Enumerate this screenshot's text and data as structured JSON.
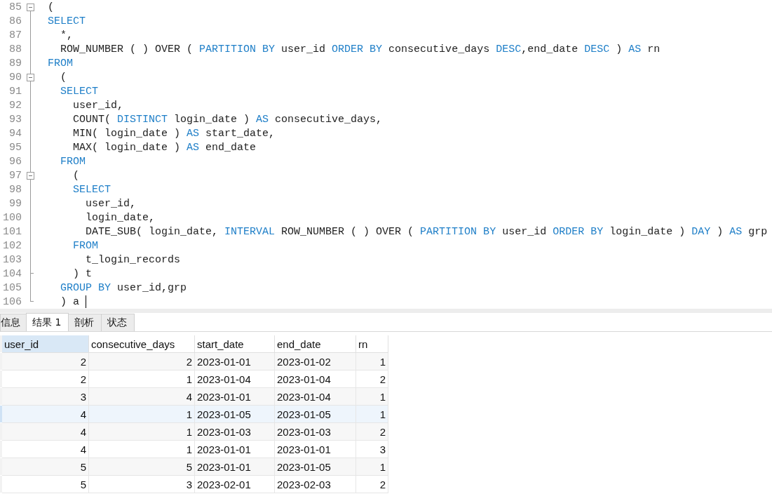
{
  "editor": {
    "lines": [
      {
        "number": "85",
        "kind": "fold-start",
        "tokens": [
          {
            "text": "(",
            "kind": "plain"
          }
        ]
      },
      {
        "number": "86",
        "kind": "code",
        "tokens": [
          {
            "text": "SELECT",
            "kind": "keyword"
          }
        ]
      },
      {
        "number": "87",
        "kind": "code",
        "tokens": [
          {
            "text": "  *,",
            "kind": "plain"
          }
        ]
      },
      {
        "number": "88",
        "kind": "code",
        "tokens": [
          {
            "text": "  ROW_NUMBER ( ) OVER ( ",
            "kind": "plain"
          },
          {
            "text": "PARTITION BY",
            "kind": "keyword"
          },
          {
            "text": " user_id ",
            "kind": "plain"
          },
          {
            "text": "ORDER BY",
            "kind": "keyword"
          },
          {
            "text": " consecutive_days ",
            "kind": "plain"
          },
          {
            "text": "DESC",
            "kind": "keyword"
          },
          {
            "text": ",end_date ",
            "kind": "plain"
          },
          {
            "text": "DESC",
            "kind": "keyword"
          },
          {
            "text": " ) ",
            "kind": "plain"
          },
          {
            "text": "AS",
            "kind": "keyword"
          },
          {
            "text": " rn",
            "kind": "plain"
          }
        ]
      },
      {
        "number": "89",
        "kind": "code",
        "tokens": [
          {
            "text": "FROM",
            "kind": "keyword"
          }
        ]
      },
      {
        "number": "90",
        "kind": "fold-start",
        "tokens": [
          {
            "text": "  (",
            "kind": "plain"
          }
        ]
      },
      {
        "number": "91",
        "kind": "code",
        "tokens": [
          {
            "text": "  SELECT",
            "kind": "keyword"
          }
        ]
      },
      {
        "number": "92",
        "kind": "code",
        "tokens": [
          {
            "text": "    user_id,",
            "kind": "plain"
          }
        ]
      },
      {
        "number": "93",
        "kind": "code",
        "tokens": [
          {
            "text": "    COUNT( ",
            "kind": "plain"
          },
          {
            "text": "DISTINCT",
            "kind": "keyword"
          },
          {
            "text": " login_date ) ",
            "kind": "plain"
          },
          {
            "text": "AS",
            "kind": "keyword"
          },
          {
            "text": " consecutive_days,",
            "kind": "plain"
          }
        ]
      },
      {
        "number": "94",
        "kind": "code",
        "tokens": [
          {
            "text": "    MIN( login_date ) ",
            "kind": "plain"
          },
          {
            "text": "AS",
            "kind": "keyword"
          },
          {
            "text": " start_date,",
            "kind": "plain"
          }
        ]
      },
      {
        "number": "95",
        "kind": "code",
        "tokens": [
          {
            "text": "    MAX( login_date ) ",
            "kind": "plain"
          },
          {
            "text": "AS",
            "kind": "keyword"
          },
          {
            "text": " end_date",
            "kind": "plain"
          }
        ]
      },
      {
        "number": "96",
        "kind": "code",
        "tokens": [
          {
            "text": "  FROM",
            "kind": "keyword"
          }
        ]
      },
      {
        "number": "97",
        "kind": "fold-start",
        "tokens": [
          {
            "text": "    (",
            "kind": "plain"
          }
        ]
      },
      {
        "number": "98",
        "kind": "code",
        "tokens": [
          {
            "text": "    SELECT",
            "kind": "keyword"
          }
        ]
      },
      {
        "number": "99",
        "kind": "code",
        "tokens": [
          {
            "text": "      user_id,",
            "kind": "plain"
          }
        ]
      },
      {
        "number": "100",
        "kind": "code",
        "tokens": [
          {
            "text": "      login_date,",
            "kind": "plain"
          }
        ]
      },
      {
        "number": "101",
        "kind": "code",
        "tokens": [
          {
            "text": "      DATE_SUB( login_date, ",
            "kind": "plain"
          },
          {
            "text": "INTERVAL",
            "kind": "keyword"
          },
          {
            "text": " ROW_NUMBER ( ) OVER ( ",
            "kind": "plain"
          },
          {
            "text": "PARTITION BY",
            "kind": "keyword"
          },
          {
            "text": " user_id ",
            "kind": "plain"
          },
          {
            "text": "ORDER BY",
            "kind": "keyword"
          },
          {
            "text": " login_date ) ",
            "kind": "plain"
          },
          {
            "text": "DAY",
            "kind": "keyword"
          },
          {
            "text": " ) ",
            "kind": "plain"
          },
          {
            "text": "AS",
            "kind": "keyword"
          },
          {
            "text": " grp",
            "kind": "plain"
          }
        ]
      },
      {
        "number": "102",
        "kind": "code",
        "tokens": [
          {
            "text": "    FROM",
            "kind": "keyword"
          }
        ]
      },
      {
        "number": "103",
        "kind": "code",
        "tokens": [
          {
            "text": "      t_login_records",
            "kind": "plain"
          }
        ]
      },
      {
        "number": "104",
        "kind": "fold-end",
        "tokens": [
          {
            "text": "    ) t",
            "kind": "plain"
          }
        ]
      },
      {
        "number": "105",
        "kind": "code",
        "tokens": [
          {
            "text": "  GROUP BY",
            "kind": "keyword"
          },
          {
            "text": " user_id,grp",
            "kind": "plain"
          }
        ]
      },
      {
        "number": "106",
        "kind": "fold-end",
        "cursor": true,
        "tokens": [
          {
            "text": "  ) a ",
            "kind": "plain"
          }
        ]
      }
    ]
  },
  "tabs": [
    {
      "label": "信息",
      "selected": false
    },
    {
      "label": "结果 1",
      "selected": true
    },
    {
      "label": "剖析",
      "selected": false
    },
    {
      "label": "状态",
      "selected": false
    }
  ],
  "table": {
    "columns": [
      {
        "label": "user_id",
        "kind": "number",
        "selected": true
      },
      {
        "label": "consecutive_days",
        "kind": "number",
        "selected": false
      },
      {
        "label": "start_date",
        "kind": "date",
        "selected": false
      },
      {
        "label": "end_date",
        "kind": "date",
        "selected": false
      },
      {
        "label": "rn",
        "kind": "number",
        "selected": false
      }
    ],
    "rows": [
      {
        "selected": false,
        "cells": [
          "2",
          "2",
          "2023-01-01",
          "2023-01-02",
          "1"
        ]
      },
      {
        "selected": false,
        "cells": [
          "2",
          "1",
          "2023-01-04",
          "2023-01-04",
          "2"
        ]
      },
      {
        "selected": false,
        "cells": [
          "3",
          "4",
          "2023-01-01",
          "2023-01-04",
          "1"
        ]
      },
      {
        "selected": true,
        "cells": [
          "4",
          "1",
          "2023-01-05",
          "2023-01-05",
          "1"
        ]
      },
      {
        "selected": false,
        "cells": [
          "4",
          "1",
          "2023-01-03",
          "2023-01-03",
          "2"
        ]
      },
      {
        "selected": false,
        "cells": [
          "4",
          "1",
          "2023-01-01",
          "2023-01-01",
          "3"
        ]
      },
      {
        "selected": false,
        "cells": [
          "5",
          "5",
          "2023-01-01",
          "2023-01-05",
          "1"
        ]
      },
      {
        "selected": false,
        "cells": [
          "5",
          "3",
          "2023-02-01",
          "2023-02-03",
          "2"
        ]
      }
    ]
  }
}
